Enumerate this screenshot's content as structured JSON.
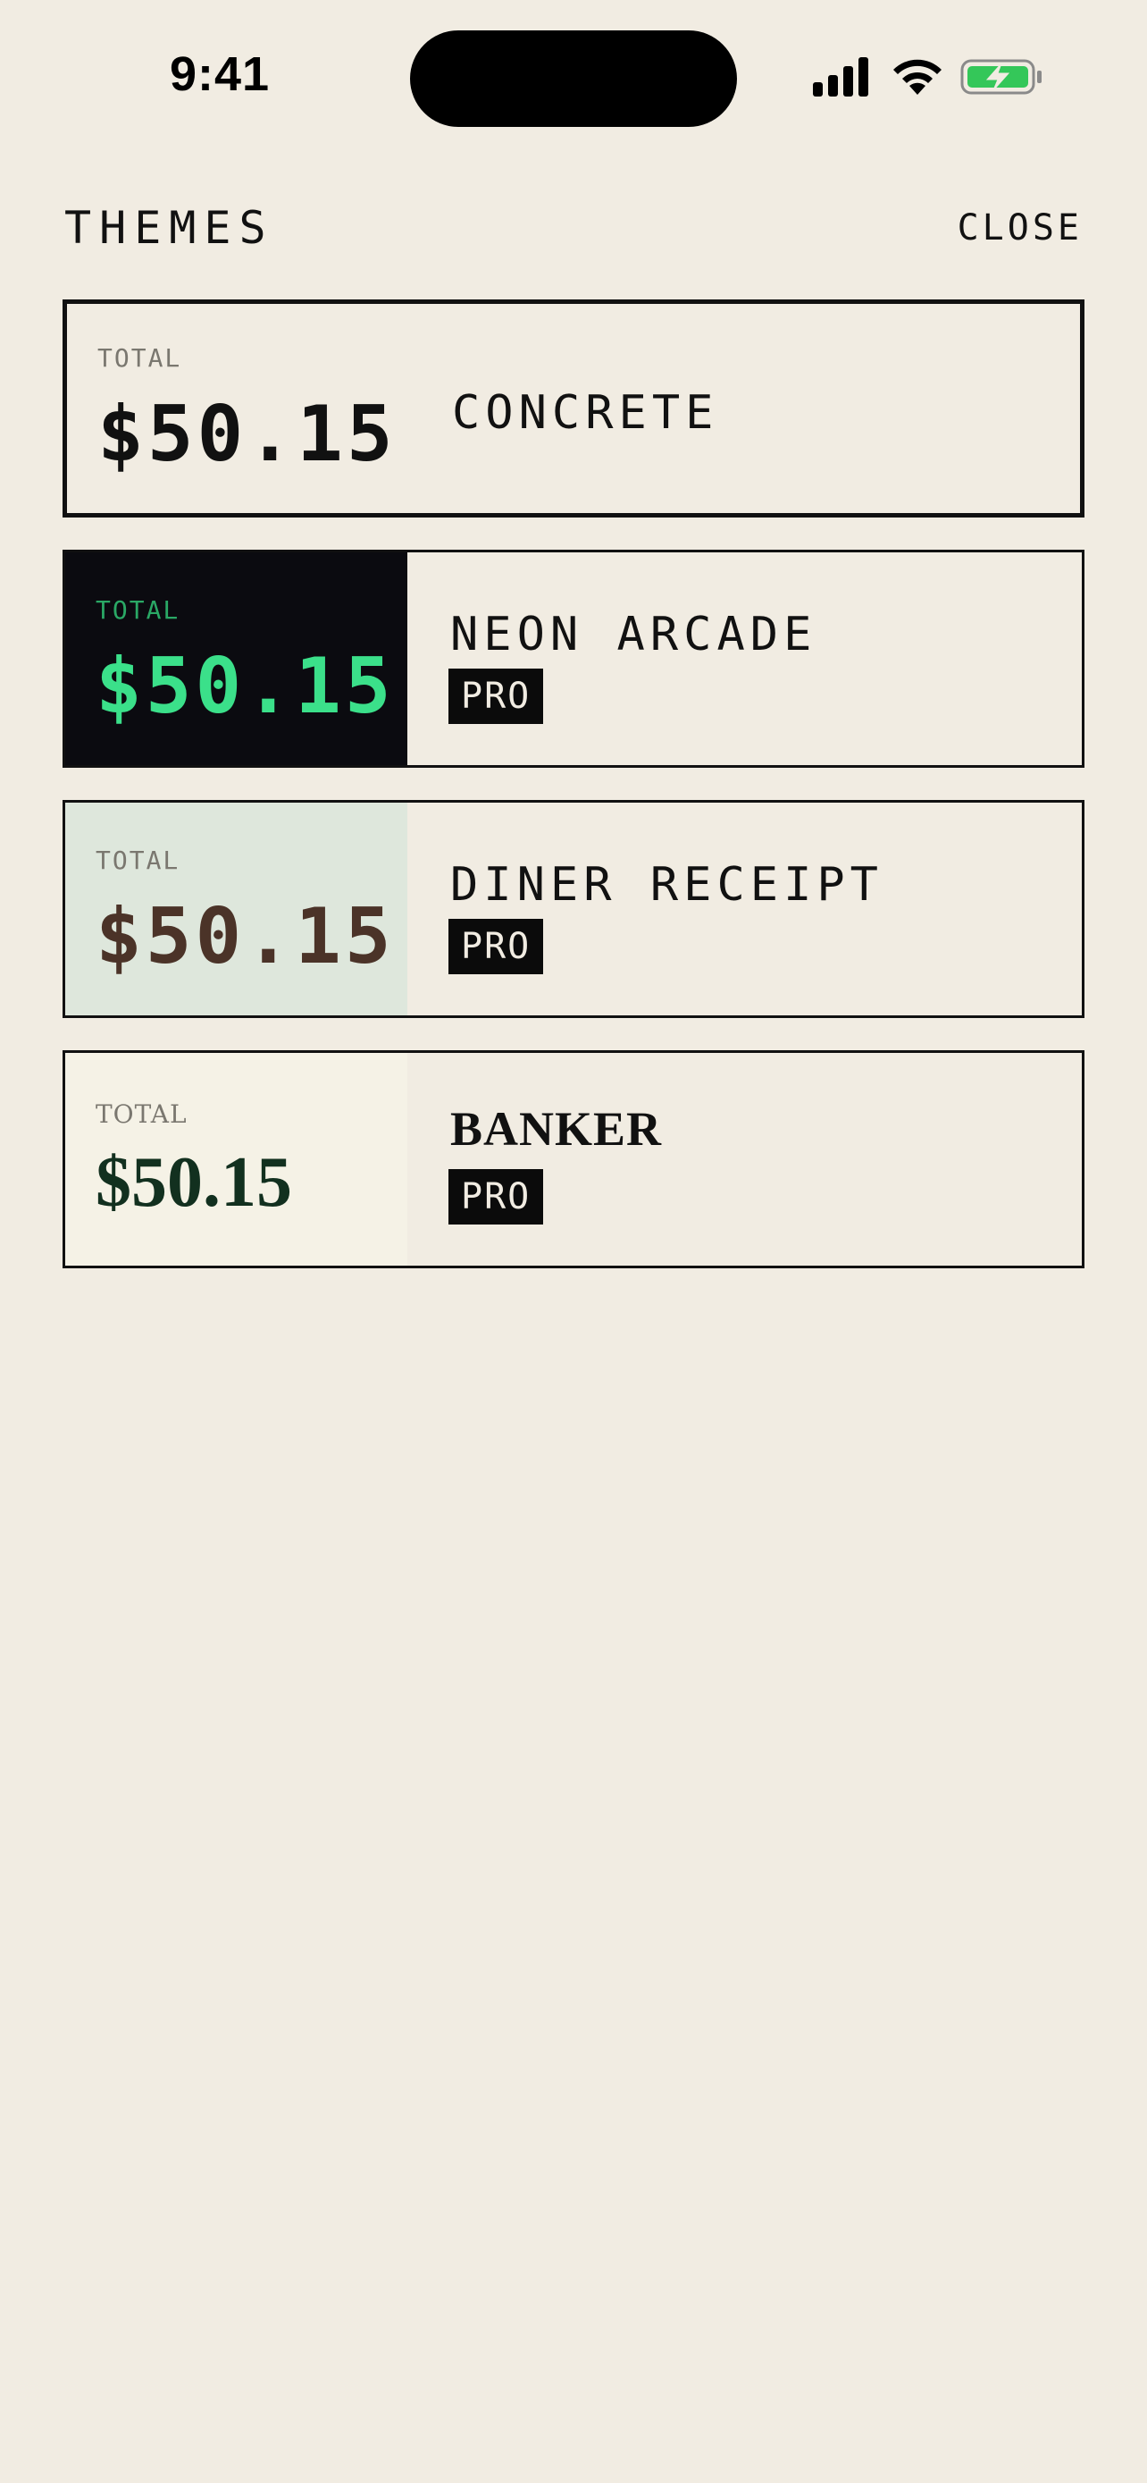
{
  "status_bar": {
    "time": "9:41",
    "icons": [
      "cellular-signal-icon",
      "wifi-icon",
      "battery-charging-icon"
    ],
    "battery_color": "#34c759"
  },
  "header": {
    "title": "THEMES",
    "close_label": "CLOSE"
  },
  "themes": [
    {
      "name": "CONCRETE",
      "total_label": "TOTAL",
      "amount": "$50.15",
      "pro": false,
      "selected": true,
      "preview_bg": "#f1ece2",
      "amount_color": "#111111"
    },
    {
      "name": "NEON ARCADE",
      "total_label": "TOTAL",
      "amount": "$50.15",
      "pro": true,
      "pro_label": "PRO",
      "preview_bg": "#0b0b10",
      "amount_color": "#3be08a"
    },
    {
      "name": "DINER RECEIPT",
      "total_label": "TOTAL",
      "amount": "$50.15",
      "pro": true,
      "pro_label": "PRO",
      "preview_bg": "#dee7dc",
      "amount_color": "#4b3328"
    },
    {
      "name": "BANKER",
      "total_label": "TOTAL",
      "amount": "$50.15",
      "pro": true,
      "pro_label": "PRO",
      "preview_bg": "#f5f2e6",
      "amount_color": "#12301f"
    }
  ]
}
